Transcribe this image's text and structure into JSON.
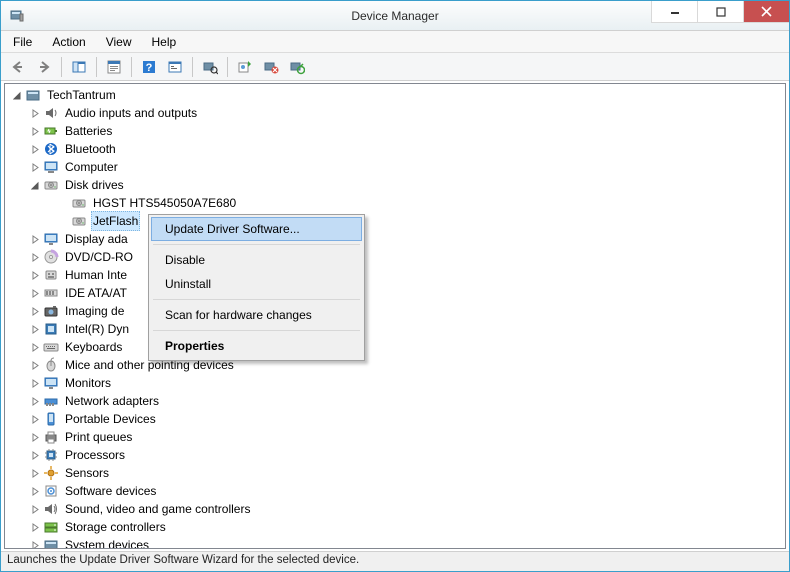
{
  "window": {
    "title": "Device Manager"
  },
  "menu": {
    "file": "File",
    "action": "Action",
    "view": "View",
    "help": "Help"
  },
  "tree": {
    "root": "TechTantrum",
    "nodes": [
      {
        "label": "Audio inputs and outputs",
        "icon": "audio"
      },
      {
        "label": "Batteries",
        "icon": "battery"
      },
      {
        "label": "Bluetooth",
        "icon": "bluetooth"
      },
      {
        "label": "Computer",
        "icon": "computer"
      },
      {
        "label": "Disk drives",
        "icon": "disk",
        "expanded": true,
        "children": [
          {
            "label": "HGST HTS545050A7E680",
            "icon": "disk"
          },
          {
            "label": "JetFlash",
            "icon": "disk",
            "selected": true
          }
        ]
      },
      {
        "label": "Display ada",
        "icon": "display",
        "cut": true
      },
      {
        "label": "DVD/CD-RO",
        "icon": "dvd",
        "cut": true
      },
      {
        "label": "Human Inte",
        "icon": "hid",
        "cut": true
      },
      {
        "label": "IDE ATA/AT",
        "icon": "ide",
        "cut": true
      },
      {
        "label": "Imaging de",
        "icon": "imaging",
        "cut": true
      },
      {
        "label": "Intel(R) Dyn",
        "icon": "intel",
        "cut": true
      },
      {
        "label": "Keyboards",
        "icon": "keyboard"
      },
      {
        "label": "Mice and other pointing devices",
        "icon": "mouse"
      },
      {
        "label": "Monitors",
        "icon": "monitor"
      },
      {
        "label": "Network adapters",
        "icon": "network"
      },
      {
        "label": "Portable Devices",
        "icon": "portable"
      },
      {
        "label": "Print queues",
        "icon": "printer"
      },
      {
        "label": "Processors",
        "icon": "cpu"
      },
      {
        "label": "Sensors",
        "icon": "sensor"
      },
      {
        "label": "Software devices",
        "icon": "software"
      },
      {
        "label": "Sound, video and game controllers",
        "icon": "sound"
      },
      {
        "label": "Storage controllers",
        "icon": "storage"
      },
      {
        "label": "System devices",
        "icon": "system",
        "partial": true
      }
    ]
  },
  "context_menu": {
    "update": "Update Driver Software...",
    "disable": "Disable",
    "uninstall": "Uninstall",
    "scan": "Scan for hardware changes",
    "properties": "Properties"
  },
  "statusbar": "Launches the Update Driver Software Wizard for the selected device."
}
